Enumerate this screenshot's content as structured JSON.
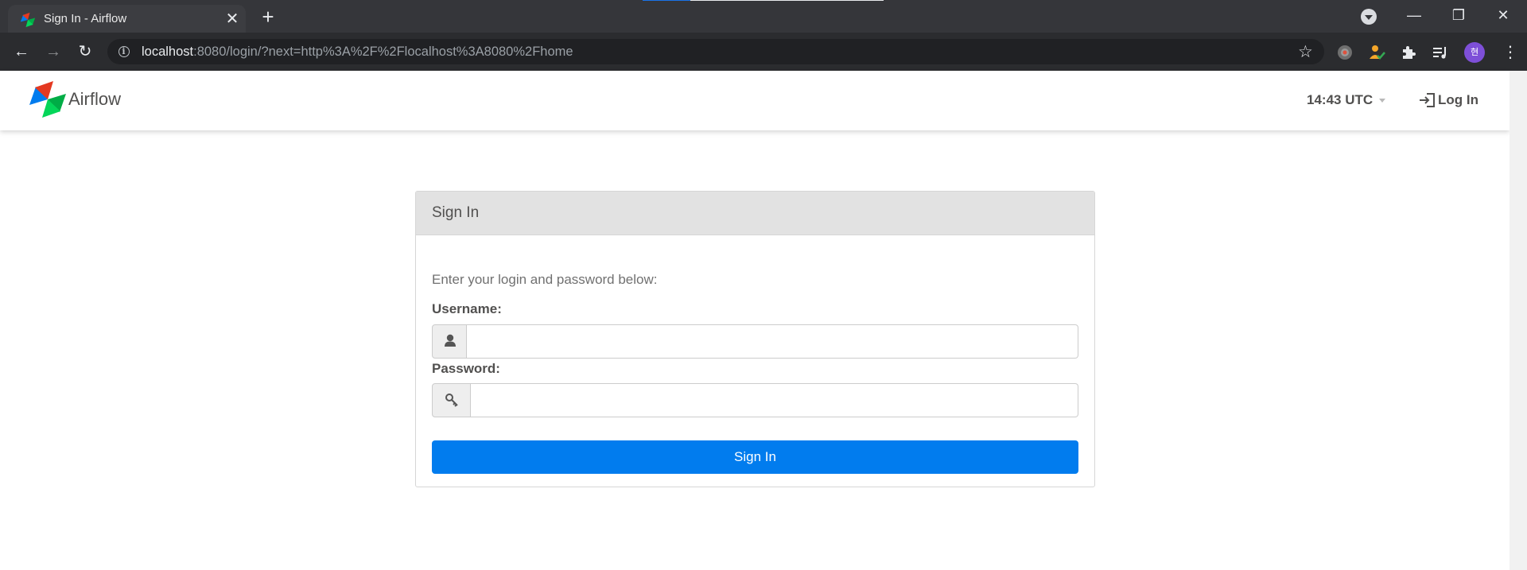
{
  "browser": {
    "tab_title": "Sign In - Airflow",
    "url_host": "localhost",
    "url_rest": ":8080/login/?next=http%3A%2F%2Flocalhost%3A8080%2Fhome",
    "profile_initial": "현",
    "close_glyph": "✕",
    "new_tab_glyph": "+",
    "minimize_glyph": "—",
    "restore_glyph": "❐",
    "window_close_glyph": "✕",
    "back_glyph": "←",
    "forward_glyph": "→",
    "reload_glyph": "↻",
    "star_glyph": "☆",
    "menu_glyph": "⋮"
  },
  "navbar": {
    "brand": "Airflow",
    "clock": "14:43 UTC",
    "login_label": "Log In"
  },
  "login_panel": {
    "title": "Sign In",
    "intro": "Enter your login and password below:",
    "username_label": "Username:",
    "username_value": "",
    "password_label": "Password:",
    "password_value": "",
    "submit_label": "Sign In"
  },
  "colors": {
    "primary_button": "#017cee",
    "panel_heading": "#e2e2e2",
    "text": "#51504f",
    "profile_avatar": "#7e4fd8"
  },
  "icons": {
    "username_addon": "user-icon",
    "password_addon": "key-icon",
    "login": "sign-in-icon",
    "brand": "airflow-pinwheel-logo"
  }
}
